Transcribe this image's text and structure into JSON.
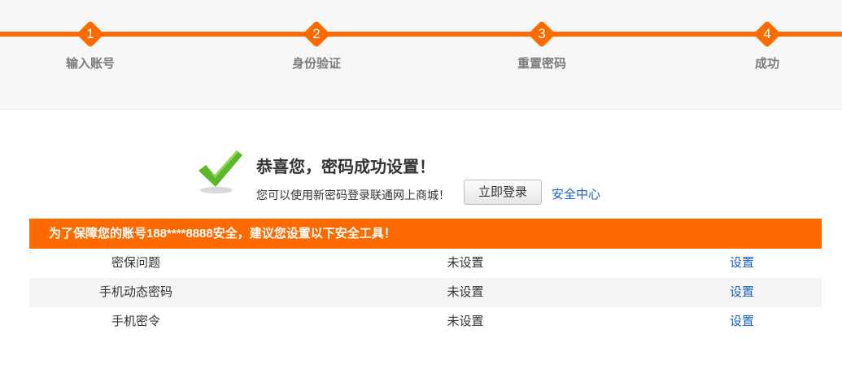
{
  "steps": [
    {
      "num": "1",
      "label": "输入账号"
    },
    {
      "num": "2",
      "label": "身份验证"
    },
    {
      "num": "3",
      "label": "重置密码"
    },
    {
      "num": "4",
      "label": "成功"
    }
  ],
  "result": {
    "title": "恭喜您，密码成功设置！",
    "subtitle": "您可以使用新密码登录联通网上商城！",
    "login_button": "立即登录",
    "security_link": "安全中心"
  },
  "banner": {
    "text": "为了保障您的账号188****8888安全，建议您设置以下安全工具！"
  },
  "tools": [
    {
      "name": "密保问题",
      "status": "未设置",
      "action": "设置"
    },
    {
      "name": "手机动态密码",
      "status": "未设置",
      "action": "设置"
    },
    {
      "name": "手机密令",
      "status": "未设置",
      "action": "设置"
    }
  ],
  "colors": {
    "accent": "#ff6a00",
    "link": "#1b5fbd",
    "check": "#5cb82a"
  }
}
